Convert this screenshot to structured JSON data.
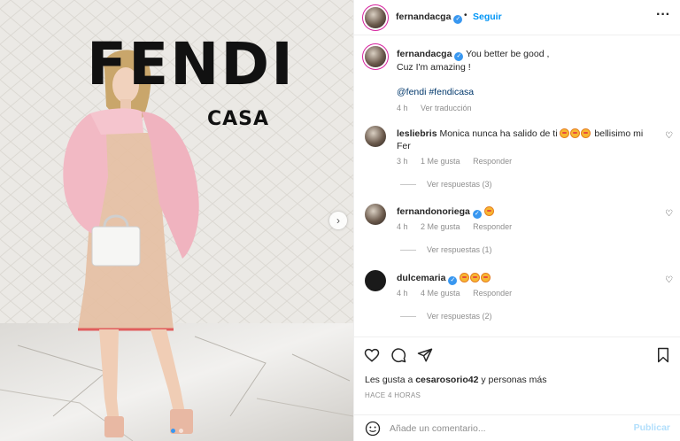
{
  "photo": {
    "brand": "FENDI",
    "brand_sub": "CASA",
    "carousel_dots": 2,
    "active_dot": 0
  },
  "header": {
    "username": "fernandacga",
    "follow_label": "Seguir",
    "separator": "•",
    "more_label": "···"
  },
  "caption": {
    "username": "fernandacga",
    "text_line1": "You better be good ,",
    "text_line2": "Cuz I'm amazing !",
    "tags": "@fendi #fendicasa",
    "time": "4 h",
    "translate": "Ver traducción"
  },
  "comments": [
    {
      "username": "lesliebris",
      "text_before": "Monica nunca ha salido de ti",
      "emoji_count": 3,
      "text_after": "bellisimo mi Fer",
      "time": "3 h",
      "likes": "1 Me gusta",
      "reply": "Responder",
      "replies": "Ver respuestas (3)"
    },
    {
      "username": "fernandonoriega",
      "text_before": "",
      "emoji_count": 1,
      "text_after": "",
      "time": "4 h",
      "likes": "2 Me gusta",
      "reply": "Responder",
      "replies": "Ver respuestas (1)"
    },
    {
      "username": "dulcemaria",
      "text_before": "",
      "emoji_count": 3,
      "text_after": "",
      "time": "4 h",
      "likes": "4 Me gusta",
      "reply": "Responder",
      "replies": "Ver respuestas (2)"
    }
  ],
  "actions": {
    "icons": [
      "heart-icon",
      "comment-icon",
      "share-icon",
      "bookmark-icon"
    ],
    "likes_prefix": "Les gusta a",
    "likes_user": "cesarosorio42",
    "likes_suffix": "y personas más",
    "time": "HACE 4 HORAS"
  },
  "comment_bar": {
    "placeholder": "Añade un comentario...",
    "publish_label": "Publicar"
  },
  "colors": {
    "accent": "#0095f6",
    "verified": "#3897f0",
    "muted": "#8e8e8e",
    "publish_disabled": "#b2dffc"
  }
}
